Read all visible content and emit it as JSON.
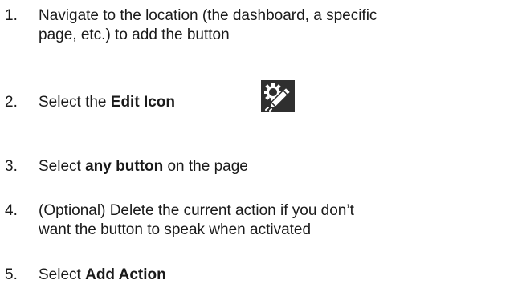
{
  "steps": [
    {
      "number": "1.",
      "line1": "Navigate to the location (the dashboard, a specific",
      "line2": "page, etc.) to add the button"
    },
    {
      "number": "2.",
      "prefix": "Select the ",
      "bold": "Edit Icon",
      "icon": "edit-settings-icon"
    },
    {
      "number": "3.",
      "prefix": "Select ",
      "bold": "any button",
      "suffix": " on the page"
    },
    {
      "number": "4.",
      "line1": "(Optional) Delete the current action if you don’t",
      "line2": "want the button to speak when activated"
    },
    {
      "number": "5.",
      "prefix": "Select ",
      "bold": "Add Action"
    }
  ]
}
